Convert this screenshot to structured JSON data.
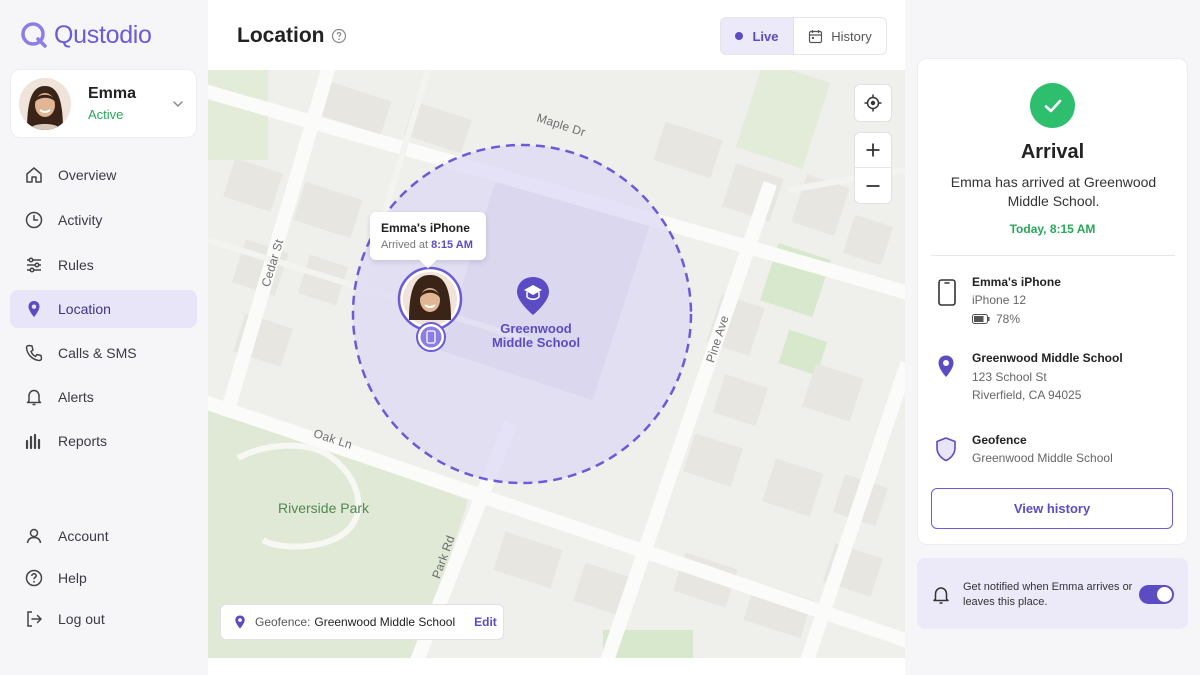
{
  "app": {
    "name": "Qustodio"
  },
  "profile": {
    "name": "Emma",
    "status": "Active"
  },
  "nav": {
    "overview": "Overview",
    "activity": "Activity",
    "rules": "Rules",
    "location": "Location",
    "calls": "Calls & SMS",
    "alerts": "Alerts",
    "reports": "Reports",
    "account": "Account",
    "help": "Help",
    "logout": "Log out"
  },
  "header": {
    "title": "Location",
    "live_label": "Live",
    "history_label": "History"
  },
  "map": {
    "streets": {
      "maple": "Maple Dr",
      "cedar": "Cedar St",
      "pine": "Pine Ave",
      "oak": "Oak Ln",
      "park": "Park Rd"
    },
    "park_label": "Riverside Park",
    "tooltip": {
      "device": "Emma's iPhone",
      "arrived_prefix": "Arrived at",
      "arrived_time": "8:15 AM"
    },
    "school_label_line1": "Greenwood",
    "school_label_line2": "Middle School",
    "geofence_pill": {
      "label": "Geofence:",
      "value": "Greenwood Middle School",
      "edit": "Edit"
    }
  },
  "arrival": {
    "title": "Arrival",
    "message": "Emma has arrived at Greenwood Middle School.",
    "time": "Today, 8:15 AM"
  },
  "device": {
    "name": "Emma's iPhone",
    "model": "iPhone 12",
    "battery": "78%"
  },
  "place": {
    "name": "Greenwood Middle School",
    "street": "123 School St",
    "city": "Riverfield, CA 94025"
  },
  "geofence": {
    "title": "Geofence",
    "value": "Greenwood Middle School"
  },
  "view_history": "View history",
  "notification": {
    "text": "Get notified when Emma arrives or leaves this place.",
    "enabled": true
  },
  "colors": {
    "accent": "#5b4cc4",
    "success": "#2ebf6e",
    "geofence_fill": "#ddd8f5"
  },
  "icons": {
    "overview": "home-icon",
    "activity": "clock-icon",
    "rules": "sliders-icon",
    "location": "pin-icon",
    "calls": "phone-icon",
    "alerts": "bell-icon",
    "reports": "bar-chart-icon",
    "account": "user-icon",
    "help": "help-circle-icon",
    "logout": "logout-icon"
  }
}
